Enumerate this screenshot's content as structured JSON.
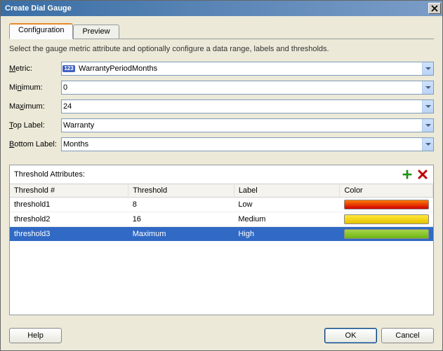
{
  "window": {
    "title": "Create Dial Gauge"
  },
  "tabs": {
    "configuration": "Configuration",
    "preview": "Preview"
  },
  "instruction": "Select the gauge metric attribute and optionally configure a data range, labels and thresholds.",
  "form": {
    "metric_label": "Metric:",
    "metric_value": "WarrantyPeriodMonths",
    "minimum_label": "Minimum:",
    "minimum_value": "0",
    "maximum_label": "Maximum:",
    "maximum_value": "24",
    "top_label_label": "Top Label:",
    "top_label_value": "Warranty",
    "bottom_label_label": "Bottom Label:",
    "bottom_label_value": "Months"
  },
  "thresholds": {
    "title": "Threshold Attributes:",
    "columns": {
      "num": "Threshold #",
      "threshold": "Threshold",
      "label": "Label",
      "color": "Color"
    },
    "rows": [
      {
        "name": "threshold1",
        "threshold": "8",
        "label": "Low",
        "color": "red"
      },
      {
        "name": "threshold2",
        "threshold": "16",
        "label": "Medium",
        "color": "yellow"
      },
      {
        "name": "threshold3",
        "threshold": "Maximum",
        "label": "High",
        "color": "green",
        "selected": true
      }
    ]
  },
  "buttons": {
    "help": "Help",
    "ok": "OK",
    "cancel": "Cancel"
  }
}
